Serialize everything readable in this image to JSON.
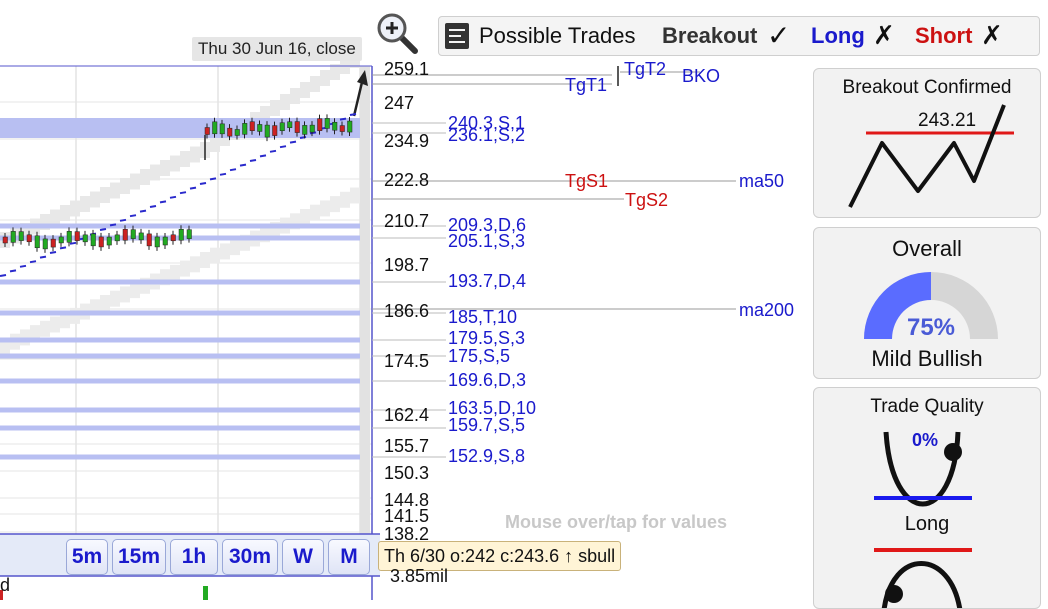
{
  "header": {
    "zoom_tooltip": "Thu 30 Jun 16, close",
    "possible_trades_label": "Possible Trades",
    "breakout_label": "Breakout",
    "breakout_mark": "✓",
    "long_label": "Long",
    "long_mark": "✗",
    "short_label": "Short",
    "short_mark": "✗"
  },
  "colors": {
    "breakout": "#333333",
    "long": "#1a1acc",
    "short": "#cc1111",
    "level_text": "#1a1acc",
    "target_red": "#cc1111",
    "gauge_fill": "#5a6cff"
  },
  "price_axis": [
    "259.1",
    "247",
    "234.9",
    "222.8",
    "210.7",
    "198.7",
    "186.6",
    "174.5",
    "162.4",
    "155.7",
    "150.3",
    "144.8",
    "141.5",
    "138.2"
  ],
  "levels": [
    "240.3,S,1",
    "236.1,S,2",
    "209.3,D,6",
    "205.1,S,3",
    "193.7,D,4",
    "185,T,10",
    "179.5,S,3",
    "175,S,5",
    "169.6,D,3",
    "163.5,D,10",
    "159.7,S,5",
    "152.9,S,8"
  ],
  "targets": {
    "tgt1": "TgT1",
    "tgt2": "TgT2",
    "bko": "BKO",
    "tgs1": "TgS1",
    "tgs2": "TgS2",
    "ma50": "ma50",
    "ma200": "ma200"
  },
  "timeframes": [
    "5m",
    "15m",
    "1h",
    "30m",
    "W",
    "M"
  ],
  "hint": "Mouse over/tap for values",
  "status_tooltip": "Th 6/30 o:242 c:243.6 ↑ sbull",
  "volume_label": "3.85mil",
  "left_fragment": "d",
  "panels": {
    "breakout": {
      "title": "Breakout Confirmed",
      "value": "243.21"
    },
    "overall": {
      "title": "Overall",
      "percent_text": "75%",
      "percent": 75,
      "status": "Mild Bullish"
    },
    "trade_quality": {
      "title": "Trade Quality",
      "percent_text": "0%",
      "long_label": "Long"
    }
  }
}
